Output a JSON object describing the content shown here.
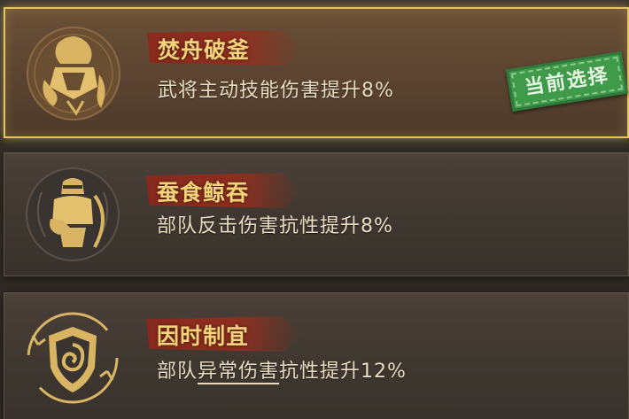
{
  "selected_label": "当前选择",
  "options": [
    {
      "title": "焚舟破釜",
      "description": "武将主动技能伤害提升8%",
      "icon": "armored-general-icon",
      "selected": true
    },
    {
      "title": "蚕食鲸吞",
      "description": "部队反击伤害抗性提升8%",
      "icon": "soldier-counterattack-icon",
      "selected": false
    },
    {
      "title": "因时制宜",
      "description_parts": [
        "部队",
        "异常伤害",
        "抗性提升12%"
      ],
      "icon": "spiral-shield-icon",
      "selected": false
    }
  ],
  "colors": {
    "selected_border": "#e4c462",
    "title_text": "#f4d27a",
    "ribbon": "#962d1e",
    "stamp": "#3f9a4a",
    "emblem_gold": "#d9b463"
  }
}
